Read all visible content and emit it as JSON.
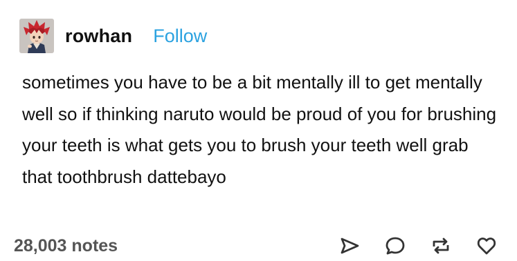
{
  "post": {
    "author": {
      "username": "rowhan",
      "avatar_icon": "anime-figure-avatar"
    },
    "follow_label": "Follow",
    "body": "sometimes you have to be a bit mentally ill to get mentally well so if thinking naruto would be proud of you for brushing your teeth is what gets you to brush your teeth well grab that toothbrush dattebayo",
    "notes": "28,003 notes",
    "actions": {
      "share_icon": "send-arrow-icon",
      "reply_icon": "speech-bubble-icon",
      "reblog_icon": "reblog-icon",
      "like_icon": "heart-icon"
    }
  },
  "colors": {
    "follow": "#2ba2e0",
    "text": "#111111",
    "notes": "#555555",
    "icon_stroke": "#333333"
  }
}
